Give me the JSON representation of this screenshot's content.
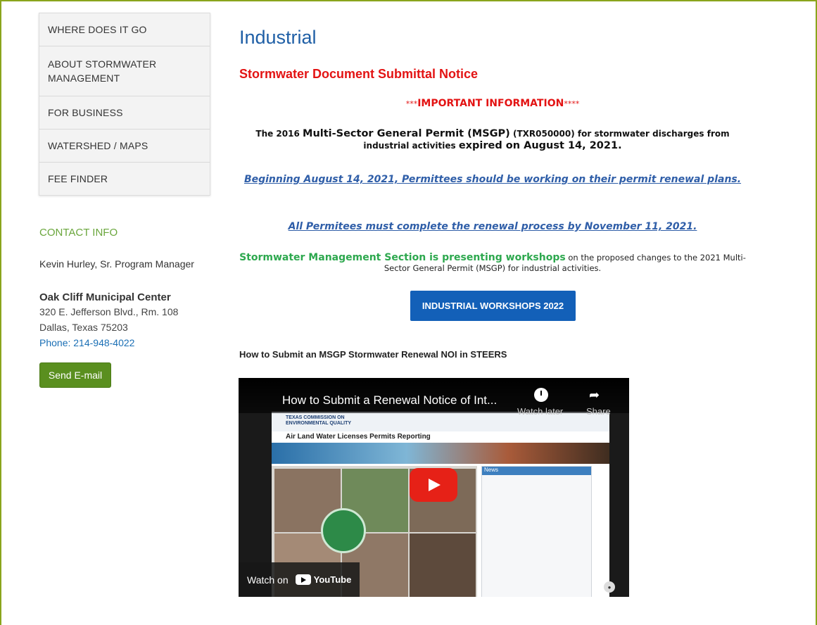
{
  "sidebar": {
    "items": [
      {
        "label": "WHERE DOES IT GO"
      },
      {
        "label": "ABOUT STORMWATER MANAGEMENT"
      },
      {
        "label": "FOR BUSINESS"
      },
      {
        "label": "WATERSHED / MAPS"
      },
      {
        "label": "FEE FINDER"
      }
    ],
    "contact_heading": "CONTACT INFO",
    "contact_name": "Kevin Hurley, Sr. Program Manager",
    "office_name": "Oak Cliff Municipal Center",
    "address_line1": "320 E. Jefferson Blvd., Rm. 108",
    "address_line2": "Dallas, Texas 75203",
    "phone": "Phone: 214-948-4022",
    "email_button": "Send E-mail"
  },
  "main": {
    "title": "Industrial",
    "notice_title": "Stormwater Document Submittal Notice",
    "important_prefix": "***",
    "important_text": "IMPORTANT INFORMATION",
    "important_suffix": "****",
    "msgp_part1": "The 2016 ",
    "msgp_part2": "Multi-Sector General Permit (MSGP)",
    "msgp_part3": " (TXR050000) for stormwater discharges from industrial activities ",
    "msgp_part4": "expired on August 14, 2021",
    "msgp_part5": ".",
    "link1": "Beginning August 14, 2021, Permittees should be working on their permit renewal plans.",
    "link2": "All Permitees must complete the renewal process by November 11, 2021.",
    "workshops_green": "Stormwater Management Section is presenting workshops",
    "workshops_rest": " on the proposed changes to the 2021 Multi-Sector General Permit (MSGP) for industrial activities.",
    "workshops_button": "INDUSTRIAL WORKSHOPS 2022",
    "howto_heading": "How to Submit an MSGP Stormwater Renewal NOI in STEERS"
  },
  "video": {
    "title": "How to Submit a Renewal Notice of Int...",
    "watch_later": "Watch later",
    "share": "Share",
    "watch_on": "Watch on",
    "youtube": "YouTube",
    "site_org_line1": "TEXAS COMMISSION ON",
    "site_org_line2": "ENVIRONMENTAL QUALITY",
    "site_nav": "Air  Land  Water  Licenses  Permits  Reporting",
    "news_heading": "News"
  }
}
